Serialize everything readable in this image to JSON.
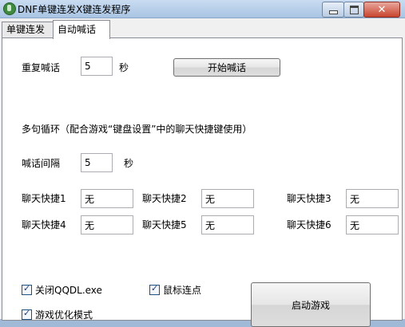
{
  "window": {
    "title": "DNF单键连发X键连发程序"
  },
  "tabs": [
    "单键连发",
    "自动喊话"
  ],
  "repeat": {
    "label": "重复喊话",
    "value": "5",
    "unit": "秒",
    "start_button": "开始喊话"
  },
  "multi_loop": {
    "heading": "多句循环（配合游戏“键盘设置”中的聊天快捷键使用）"
  },
  "interval": {
    "label": "喊话间隔",
    "value": "5",
    "unit": "秒"
  },
  "hotkeys": [
    {
      "label": "聊天快捷1",
      "value": "无"
    },
    {
      "label": "聊天快捷2",
      "value": "无"
    },
    {
      "label": "聊天快捷3",
      "value": "无"
    },
    {
      "label": "聊天快捷4",
      "value": "无"
    },
    {
      "label": "聊天快捷5",
      "value": "无"
    },
    {
      "label": "聊天快捷6",
      "value": "无"
    }
  ],
  "options": {
    "close_qqdl": {
      "label": "关闭QQDL.exe",
      "checked": true
    },
    "mouse_click": {
      "label": "鼠标连点",
      "checked": true
    },
    "game_opt": {
      "label": "游戏优化模式",
      "checked": true
    }
  },
  "launch_button": "启动游戏"
}
